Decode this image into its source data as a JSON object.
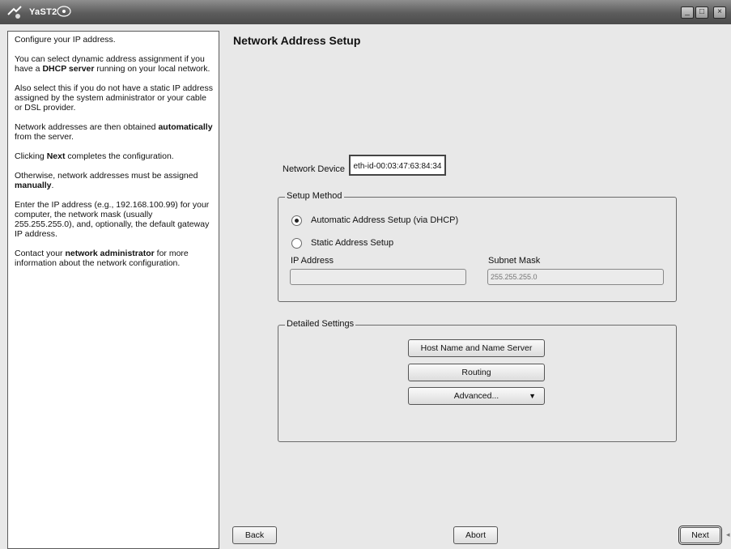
{
  "window": {
    "title": "YaST2",
    "controls": {
      "minimize": "_",
      "maximize": "□",
      "close": "×"
    }
  },
  "help": {
    "paragraphs": [
      {
        "parts": [
          {
            "t": "Configure your IP address.",
            "b": false
          }
        ]
      },
      {
        "parts": [
          {
            "t": "You can select dynamic address assignment if you have a ",
            "b": false
          },
          {
            "t": "DHCP server",
            "b": true
          },
          {
            "t": " running on your local network.",
            "b": false
          }
        ]
      },
      {
        "parts": [
          {
            "t": "Also select this if you do not have a static IP address assigned by the system administrator or your cable or DSL provider.",
            "b": false
          }
        ]
      },
      {
        "parts": [
          {
            "t": "Network addresses are then obtained ",
            "b": false
          },
          {
            "t": "automatically",
            "b": true
          },
          {
            "t": " from the server.",
            "b": false
          }
        ]
      },
      {
        "parts": [
          {
            "t": "Clicking ",
            "b": false
          },
          {
            "t": "Next",
            "b": true
          },
          {
            "t": " completes the configuration.",
            "b": false
          }
        ]
      },
      {
        "parts": [
          {
            "t": "Otherwise, network addresses must be assigned ",
            "b": false
          },
          {
            "t": "manually",
            "b": true
          },
          {
            "t": ".",
            "b": false
          }
        ]
      },
      {
        "parts": [
          {
            "t": "Enter the IP address (e.g., 192.168.100.99) for your computer, the network mask (usually 255.255.255.0), and, optionally, the default gateway IP address.",
            "b": false
          }
        ]
      },
      {
        "parts": [
          {
            "t": "Contact your ",
            "b": false
          },
          {
            "t": "network administrator",
            "b": true
          },
          {
            "t": " for more information about the network configuration.",
            "b": false
          }
        ]
      }
    ]
  },
  "page": {
    "title": "Network Address Setup"
  },
  "network_device": {
    "label": "Network Device",
    "value": "eth-id-00:03:47:63:84:34"
  },
  "setup_method": {
    "title": "Setup Method",
    "options": [
      {
        "label": "Automatic Address Setup (via DHCP)",
        "checked": true
      },
      {
        "label": "Static Address Setup",
        "checked": false
      }
    ],
    "ip_label": "IP Address",
    "ip_value": "",
    "subnet_label": "Subnet Mask",
    "subnet_placeholder": "255.255.255.0"
  },
  "detailed_settings": {
    "title": "Detailed Settings",
    "host_button": "Host Name and Name Server",
    "routing_button": "Routing",
    "advanced_button": "Advanced...",
    "advanced_arrow": "▼"
  },
  "footer": {
    "back": "Back",
    "abort": "Abort",
    "next": "Next"
  },
  "icons": [
    "yast-app-icon",
    "yast-badge-icon",
    "dropdown-arrow-icon",
    "resize-grip-icon"
  ]
}
